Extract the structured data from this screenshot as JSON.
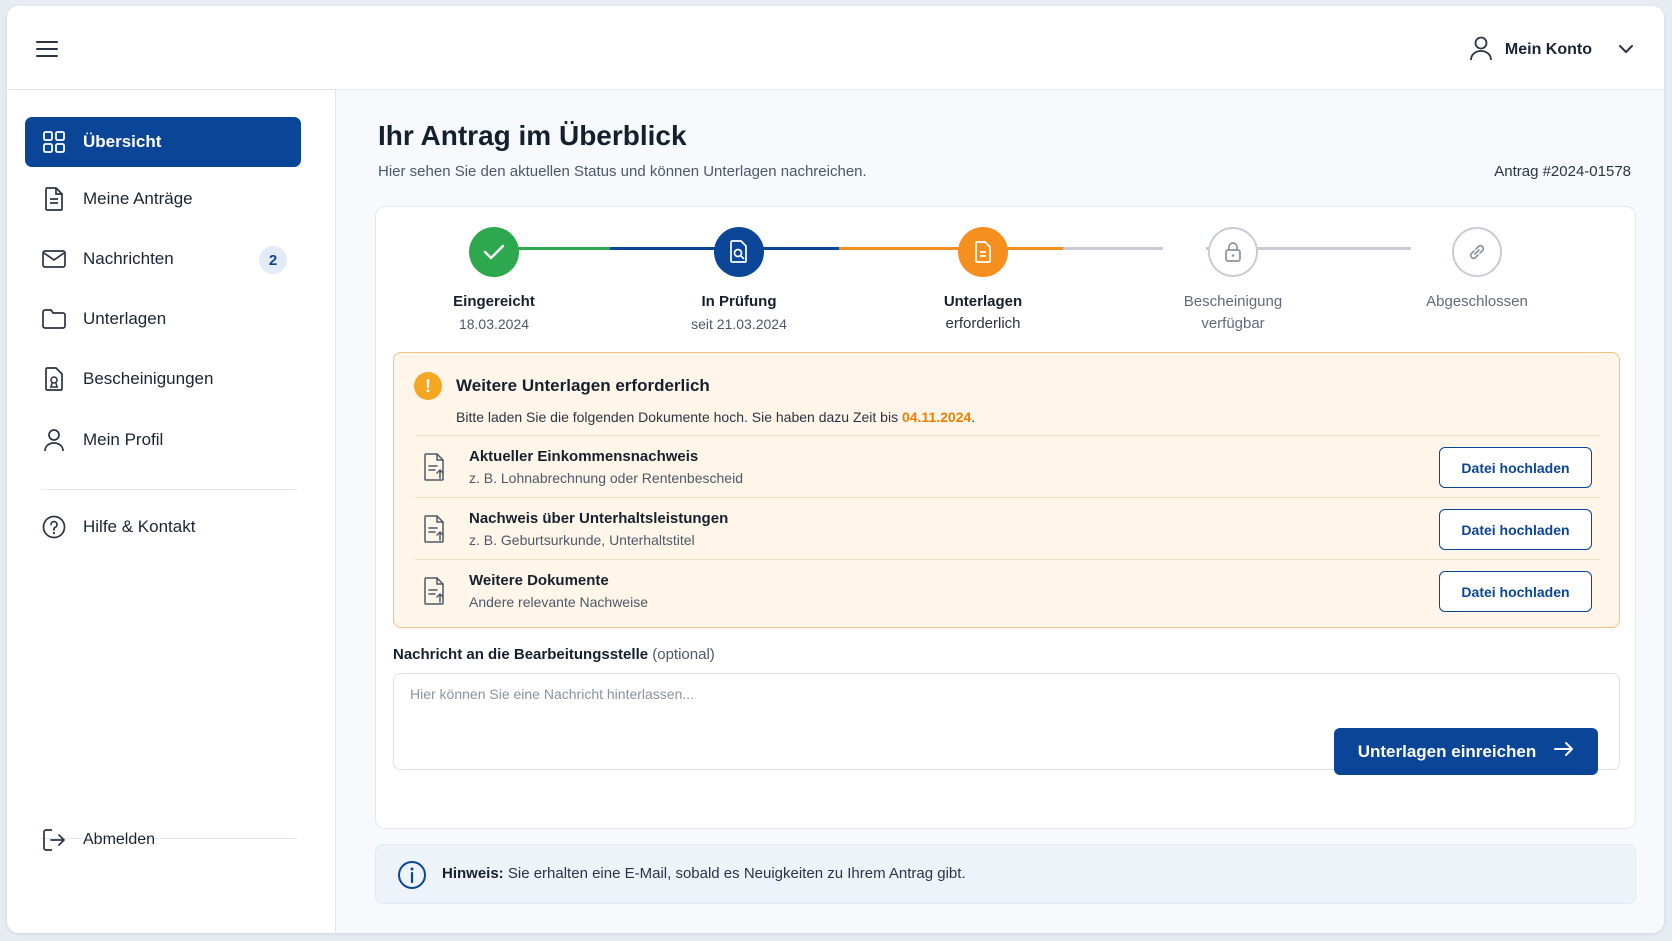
{
  "header": {
    "menu_icon": "hamburger-icon",
    "account_label": "Mein Konto",
    "account_icon": "user-icon",
    "chevron_icon": "chevron-down-icon"
  },
  "sidebar": {
    "items": [
      {
        "label": "Übersicht",
        "icon": "grid-icon",
        "active": true
      },
      {
        "label": "Meine Anträge",
        "icon": "document-icon"
      },
      {
        "label": "Nachrichten",
        "icon": "mail-icon",
        "badge": "2"
      },
      {
        "label": "Unterlagen",
        "icon": "folder-icon"
      },
      {
        "label": "Bescheinigungen",
        "icon": "certificate-icon"
      },
      {
        "label": "Mein Profil",
        "icon": "user-icon"
      }
    ],
    "help": {
      "label": "Hilfe & Kontakt",
      "icon": "help-icon"
    },
    "logout": {
      "label": "Abmelden",
      "icon": "logout-icon"
    }
  },
  "main": {
    "title": "Ihr Antrag im Überblick",
    "subtitle": "Hier sehen Sie den aktuellen Status und können Unterlagen nachreichen.",
    "antrag_number": "Antrag #2024-01578"
  },
  "stepper": {
    "steps": [
      {
        "title": "Eingereicht",
        "sub": "18.03.2024",
        "status": "done",
        "icon": "check-icon"
      },
      {
        "title": "In Prüfung",
        "sub": "seit 21.03.2024",
        "status": "in-progress",
        "icon": "document-search-icon"
      },
      {
        "title": "Unterlagen",
        "sub": "erforderlich",
        "status": "action-required",
        "icon": "document-icon"
      },
      {
        "title": "Bescheinigung",
        "sub": "verfügbar",
        "status": "locked",
        "icon": "lock-icon"
      },
      {
        "title": "Abgeschlossen",
        "sub": "",
        "status": "pending",
        "icon": "link-icon"
      }
    ]
  },
  "warning": {
    "icon": "exclamation-icon",
    "title": "Weitere Unterlagen erforderlich",
    "text_before": "Bitte laden Sie die folgenden Dokumente hoch. Sie haben dazu Zeit bis ",
    "deadline": "04.11.2024",
    "text_after": ".",
    "documents": [
      {
        "title": "Aktueller Einkommensnachweis",
        "sub": "z. B. Lohnabrechnung oder Rentenbescheid",
        "button": "Datei hochladen",
        "icon": "file-upload-icon"
      },
      {
        "title": "Nachweis über Unterhaltsleistungen",
        "sub": "z. B. Geburtsurkunde, Unterhaltstitel",
        "button": "Datei hochladen",
        "icon": "file-upload-icon"
      },
      {
        "title": "Weitere Dokumente",
        "sub": "Andere relevante Nachweise",
        "button": "Datei hochladen",
        "icon": "file-upload-icon"
      }
    ]
  },
  "message": {
    "label": "Nachricht an die Bearbeitungsstelle",
    "optional": "(optional)",
    "placeholder": "Hier können Sie eine Nachricht hinterlassen...",
    "submit": "Unterlagen einreichen",
    "submit_icon": "arrow-right-icon"
  },
  "hint": {
    "icon": "info-icon",
    "label": "Hinweis:",
    "text": " Sie erhalten eine E-Mail, sobald es Neuigkeiten zu Ihrem Antrag gibt."
  },
  "colors": {
    "primary": "#0b4597",
    "success": "#2ea84f",
    "warning": "#f5901e",
    "muted": "#c5ccd6"
  }
}
